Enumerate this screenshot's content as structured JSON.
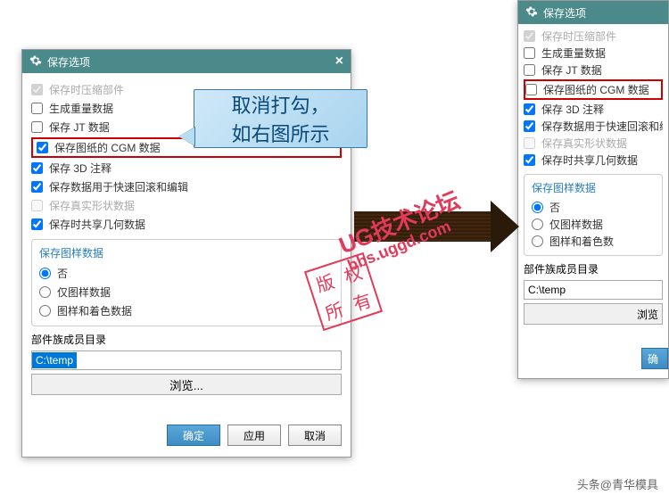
{
  "dialog": {
    "title": "保存选项",
    "opts": {
      "compress": "保存时压缩部件",
      "gen_weight": "生成重量数据",
      "save_jt": "保存 JT 数据",
      "save_cgm": "保存图纸的 CGM 数据",
      "save_3d": "保存 3D 注释",
      "fast_rollback": "保存数据用于快速回滚和编辑",
      "real_shape": "保存真实形状数据",
      "share_geom": "保存时共享几何数据"
    },
    "pattern_group": {
      "title": "保存图样数据",
      "opt_no": "否",
      "opt_pattern": "仅图样数据",
      "opt_color": "图样和着色数据"
    },
    "member_dir_label": "部件族成员目录",
    "path_value": "C:\\temp",
    "browse": "浏览...",
    "browse_partial": "浏览",
    "ok": "确定",
    "ok_partial": "确",
    "apply": "应用",
    "cancel": "取消"
  },
  "callout": {
    "line1": "取消打勾，",
    "line2": "如右图所示"
  },
  "right_variant": {
    "pattern_color": "图样和着色数"
  },
  "watermark": {
    "main": "UG技术论坛",
    "sub": "bbs.uggd.com",
    "stamp_tl": "版",
    "stamp_tr": "权",
    "stamp_bl": "所",
    "stamp_br": "有"
  },
  "credit": "头条@青华模具"
}
